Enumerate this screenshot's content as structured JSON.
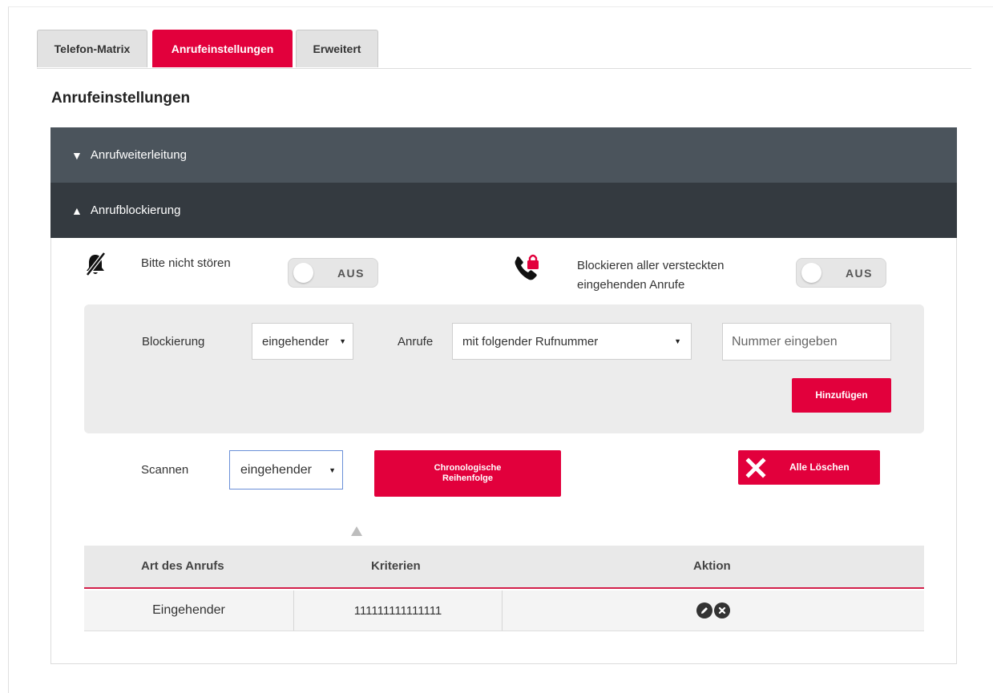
{
  "tabs": [
    {
      "label": "Telefon-Matrix",
      "active": false
    },
    {
      "label": "Anrufeinstellungen",
      "active": true
    },
    {
      "label": "Erweitert",
      "active": false
    }
  ],
  "page_title": "Anrufeinstellungen",
  "accordion": {
    "forwarding": {
      "arrow": "▼",
      "label": "Anrufweiterleitung"
    },
    "blocking": {
      "arrow": "▲",
      "label": "Anrufblockierung"
    }
  },
  "dnd": {
    "label": "Bitte nicht stören",
    "toggle": "AUS",
    "icon": "bell-slash-icon"
  },
  "hidden_calls": {
    "label_line1": "Blockieren aller versteckten",
    "label_line2": "eingehenden Anrufe",
    "toggle": "AUS",
    "icon": "phone-lock-icon"
  },
  "block_form": {
    "blockierung_label": "Blockierung",
    "direction_value": "eingehender",
    "anrufe_label": "Anrufe",
    "criteria_value": "mit folgender Rufnummer",
    "number_placeholder": "Nummer eingeben",
    "add_button": "Hinzufügen"
  },
  "scan": {
    "label": "Scannen",
    "value": "eingehender",
    "chrono_line1": "Chronologische",
    "chrono_line2": "Reihenfolge",
    "delete_all": "Alle Löschen"
  },
  "table": {
    "headers": [
      "Art des Anrufs",
      "Kriterien",
      "Aktion"
    ],
    "rows": [
      {
        "type": "Eingehender",
        "criteria": "111111111111111"
      }
    ]
  },
  "colors": {
    "accent": "#e2003c",
    "accordion_top": "#4b545c",
    "accordion_bottom": "#343a40"
  }
}
